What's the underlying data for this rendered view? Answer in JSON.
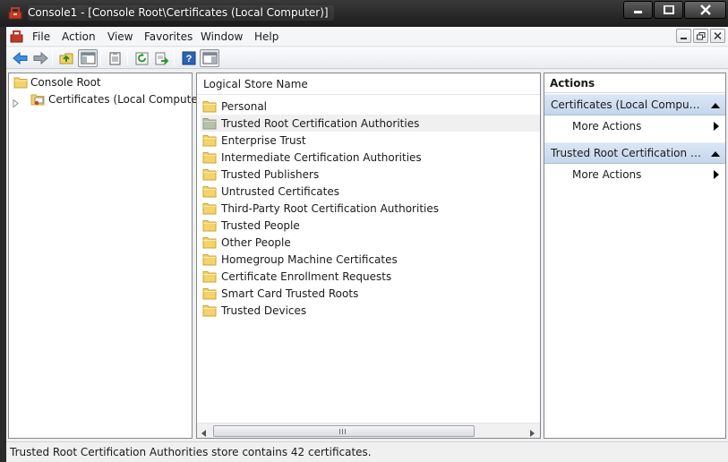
{
  "window": {
    "title": "Console1 - [Console Root\\Certificates (Local Computer)]",
    "icon": "mmc-toolbox-icon",
    "controls": [
      "minimize-icon",
      "maximize-icon",
      "close-icon"
    ]
  },
  "menubar": {
    "icon": "mmc-document-icon",
    "items": [
      "File",
      "Action",
      "View",
      "Favorites",
      "Window",
      "Help"
    ],
    "mdi_controls": [
      "minimize-icon",
      "restore-icon",
      "close-icon"
    ]
  },
  "toolbar": {
    "buttons": [
      "back-arrow-icon",
      "forward-arrow-icon",
      "up-folder-icon",
      "show-hide-tree-icon",
      "properties-icon",
      "refresh-icon",
      "export-list-icon",
      "help-icon",
      "show-hide-action-pane-icon"
    ]
  },
  "tree": {
    "items": [
      {
        "label": "Console Root",
        "icon": "folder-icon"
      },
      {
        "label": "Certificates (Local Computer)",
        "icon": "certificates-snapin-icon",
        "expander": "collapsed-triangle-icon"
      }
    ]
  },
  "list": {
    "column_header": "Logical Store Name",
    "selected_index": 1,
    "items": [
      "Personal",
      "Trusted Root Certification Authorities",
      "Enterprise Trust",
      "Intermediate Certification Authorities",
      "Trusted Publishers",
      "Untrusted Certificates",
      "Third-Party Root Certification Authorities",
      "Trusted People",
      "Other People",
      "Homegroup Machine Certificates",
      "Certificate Enrollment Requests",
      "Smart Card Trusted Roots",
      "Trusted Devices"
    ],
    "scrollbar_grip": "|||"
  },
  "actions": {
    "title": "Actions",
    "sections": [
      {
        "label": "Certificates (Local Computer)",
        "link": "More Actions"
      },
      {
        "label": "Trusted Root Certification Authorities",
        "link": "More Actions"
      }
    ]
  },
  "status": {
    "text": "Trusted Root Certification Authorities store contains 42 certificates."
  },
  "colors": {
    "folder": "#f3d46a",
    "selected_row": "#f0f0f0",
    "action_section": "#c9d9ee",
    "accent_blue": "#2a6fc9"
  }
}
